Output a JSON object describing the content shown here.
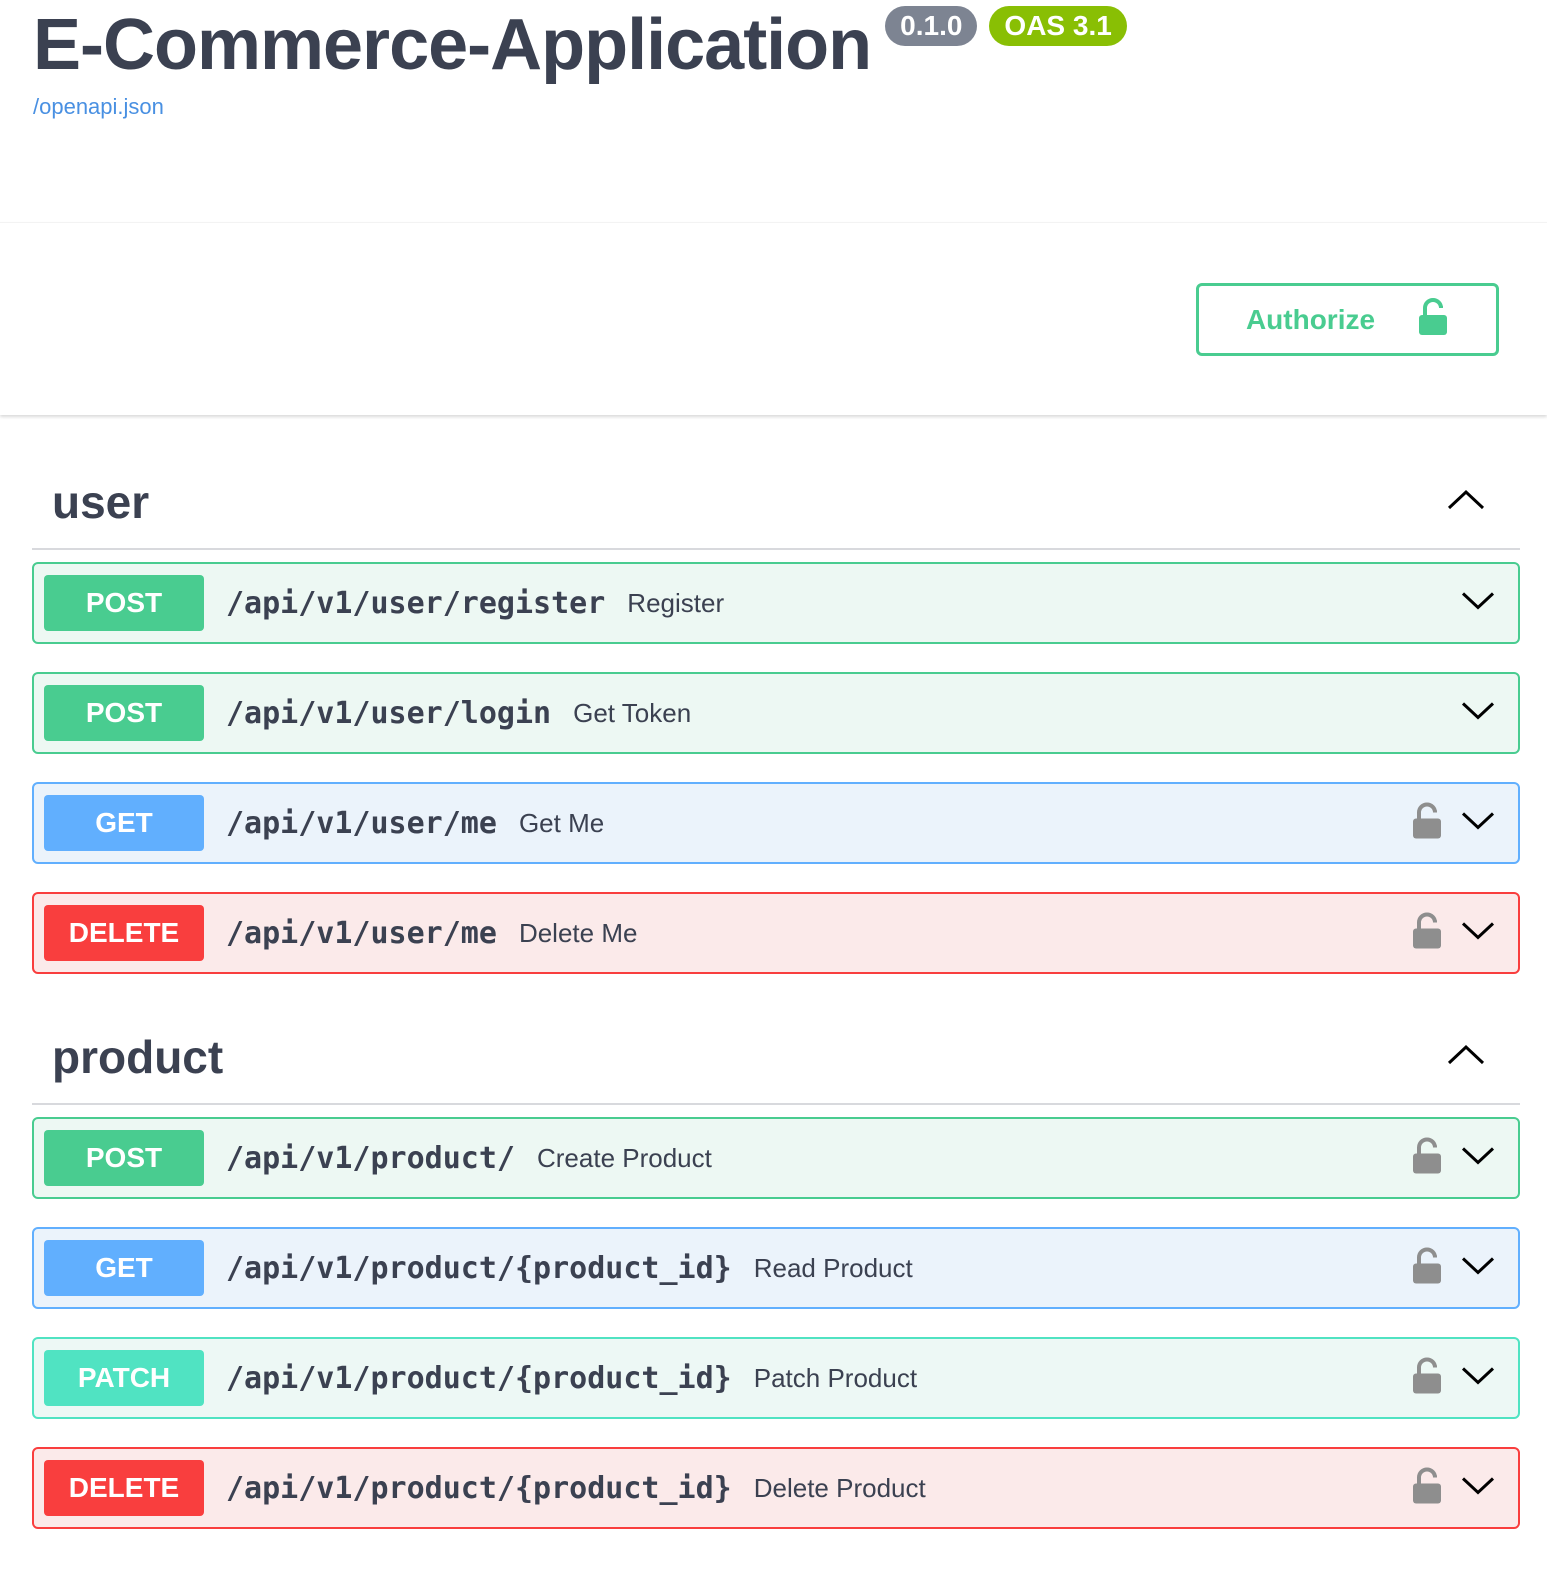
{
  "info": {
    "title": "E-Commerce-Application",
    "version": "0.1.0",
    "oas": "OAS 3.1",
    "spec_link": "/openapi.json"
  },
  "authorize": {
    "label": "Authorize",
    "icon": "unlock-icon"
  },
  "colors": {
    "post": "#49cc90",
    "get": "#61affe",
    "delete": "#f93e3e",
    "patch": "#50e3c2",
    "version_badge": "#7d8492",
    "oas_badge": "#89bf04"
  },
  "tags": [
    {
      "name": "user",
      "expanded": true,
      "operations": [
        {
          "method": "POST",
          "path": "/api/v1/user/register",
          "summary": "Register",
          "locked": false
        },
        {
          "method": "POST",
          "path": "/api/v1/user/login",
          "summary": "Get Token",
          "locked": false
        },
        {
          "method": "GET",
          "path": "/api/v1/user/me",
          "summary": "Get Me",
          "locked": true
        },
        {
          "method": "DELETE",
          "path": "/api/v1/user/me",
          "summary": "Delete Me",
          "locked": true
        }
      ]
    },
    {
      "name": "product",
      "expanded": true,
      "operations": [
        {
          "method": "POST",
          "path": "/api/v1/product/",
          "summary": "Create Product",
          "locked": true
        },
        {
          "method": "GET",
          "path": "/api/v1/product/{product_id}",
          "summary": "Read Product",
          "locked": true
        },
        {
          "method": "PATCH",
          "path": "/api/v1/product/{product_id}",
          "summary": "Patch Product",
          "locked": true
        },
        {
          "method": "DELETE",
          "path": "/api/v1/product/{product_id}",
          "summary": "Delete Product",
          "locked": true
        }
      ]
    }
  ]
}
